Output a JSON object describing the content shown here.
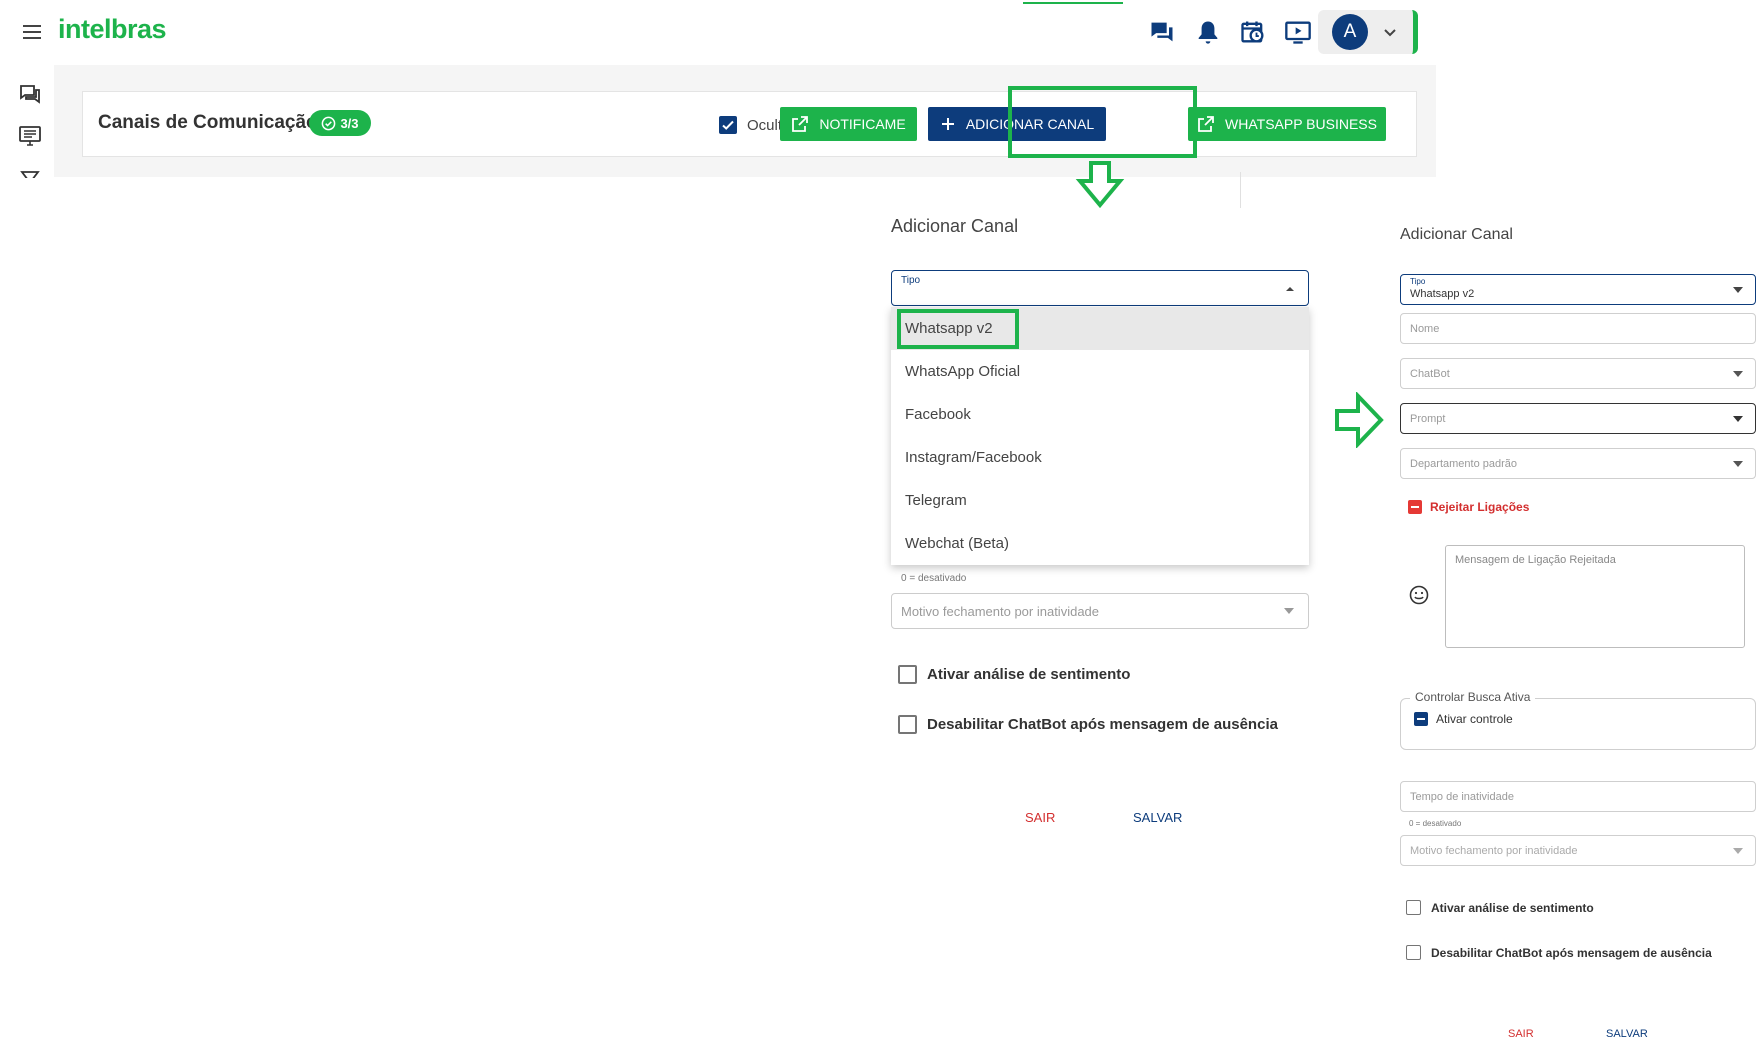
{
  "header": {
    "logo_text": "intelbras",
    "avatar_letter": "A",
    "icons": [
      "chat-icon",
      "bell-icon",
      "calendar-clock-icon",
      "presentation-icon"
    ]
  },
  "page": {
    "title": "Canais de Comunicação",
    "count_badge": "3/3",
    "hide_inactive_label": "Ocultar inativos",
    "hide_inactive_checked": true,
    "buttons": {
      "notificame": "NOTIFICAME",
      "add_channel": "ADICIONAR CANAL",
      "whatsapp_business": "WHATSAPP BUSINESS"
    }
  },
  "dialog_left": {
    "title": "Adicionar Canal",
    "tipo_label": "Tipo",
    "options": [
      "Whatsapp v2",
      "WhatsApp Oficial",
      "Facebook",
      "Instagram/Facebook",
      "Telegram",
      "Webchat (Beta)"
    ],
    "selected_option": "Whatsapp v2",
    "desativado_hint": "0 = desativado",
    "motivo_placeholder": "Motivo fechamento por inatividade",
    "sentiment_label": "Ativar análise de sentimento",
    "disable_chatbot_label": "Desabilitar ChatBot após mensagem de ausência",
    "sair": "SAIR",
    "salvar": "SALVAR"
  },
  "dialog_right": {
    "title": "Adicionar Canal",
    "tipo_label": "Tipo",
    "tipo_value": "Whatsapp v2",
    "nome_placeholder": "Nome",
    "chatbot_placeholder": "ChatBot",
    "prompt_placeholder": "Prompt",
    "departamento_placeholder": "Departamento padrão",
    "reject_calls_label": "Rejeitar Ligações",
    "reject_message_placeholder": "Mensagem de Ligação Rejeitada",
    "active_search_legend": "Controlar Busca Ativa",
    "active_control_label": "Ativar controle",
    "inactivity_time_placeholder": "Tempo de inatividade",
    "desativado_hint": "0 = desativado",
    "motivo_placeholder": "Motivo fechamento por inatividade",
    "sentiment_label": "Ativar análise de sentimento",
    "disable_chatbot_label": "Desabilitar ChatBot após mensagem de ausência",
    "sair": "SAIR",
    "salvar": "SALVAR"
  },
  "colors": {
    "brand_green": "#1db34b",
    "primary_blue": "#0d3c7c",
    "danger_red": "#d32f2f"
  }
}
